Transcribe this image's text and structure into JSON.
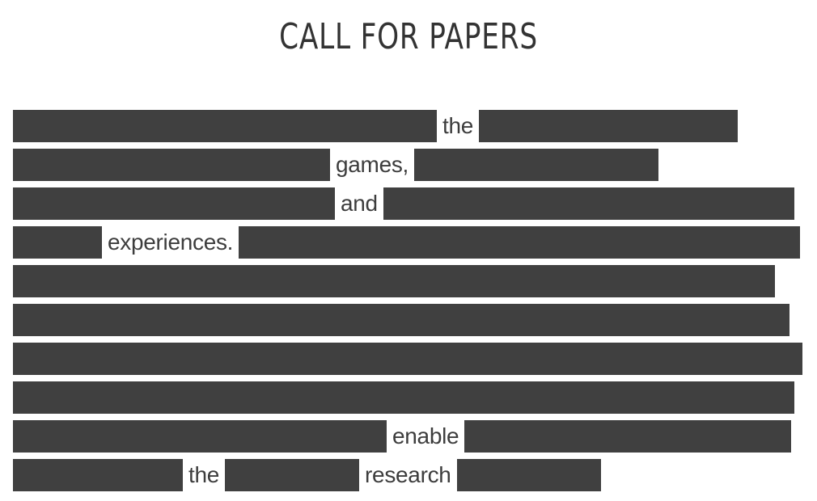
{
  "title": "CALL FOR PAPERS",
  "redaction_color": "#404040",
  "lines": [
    {
      "segments": [
        "redacted",
        "the",
        "redacted"
      ]
    },
    {
      "segments": [
        "redacted",
        "games,",
        "redacted"
      ]
    },
    {
      "segments": [
        "redacted",
        "and",
        "redacted"
      ]
    },
    {
      "segments": [
        "redacted",
        "experiences.",
        "redacted"
      ]
    },
    {
      "segments": [
        "redacted"
      ]
    },
    {
      "segments": [
        "redacted"
      ]
    },
    {
      "segments": [
        "redacted"
      ]
    },
    {
      "segments": [
        "redacted"
      ]
    },
    {
      "segments": [
        "redacted",
        "enable",
        "redacted"
      ]
    },
    {
      "segments": [
        "redacted",
        "the",
        "redacted",
        "research",
        "redacted"
      ]
    }
  ]
}
